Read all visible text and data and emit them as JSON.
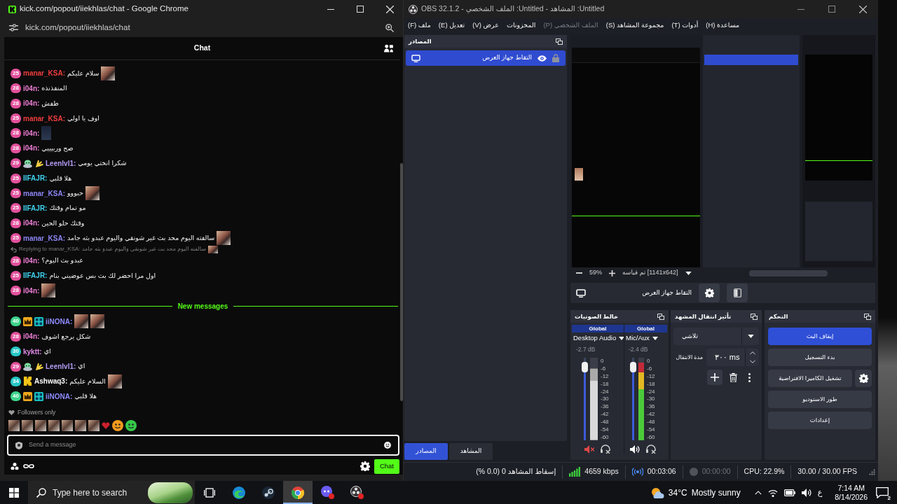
{
  "chrome": {
    "title": "kick.com/popout/iiekhlas/chat - Google Chrome",
    "url": "kick.com/popout/iiekhlas/chat"
  },
  "chat": {
    "title": "Chat",
    "messages": [
      {
        "kind": "message",
        "badge": {
          "text": "25",
          "color": "#e2519c"
        },
        "user": "manar_KSA:",
        "color": "#f23d3d",
        "text": "سلام عليكم",
        "attachments": [
          {
            "kind": "emote"
          }
        ]
      },
      {
        "kind": "message",
        "badge": {
          "text": "28",
          "color": "#e2519c"
        },
        "user": "i04n:",
        "color": "#ef7fd6",
        "text": "المنفذنذه"
      },
      {
        "kind": "message",
        "badge": {
          "text": "28",
          "color": "#e2519c"
        },
        "user": "i04n:",
        "color": "#ef7fd6",
        "text": "طفش"
      },
      {
        "kind": "message",
        "badge": {
          "text": "25",
          "color": "#e2519c"
        },
        "user": "manar_KSA:",
        "color": "#f23d3d",
        "text": "اوف يا اولي"
      },
      {
        "kind": "message",
        "badge": {
          "text": "28",
          "color": "#e2519c"
        },
        "user": "i04n:",
        "color": "#ef7fd6",
        "attachments": [
          {
            "kind": "sticker"
          }
        ]
      },
      {
        "kind": "message",
        "badge": {
          "text": "28",
          "color": "#e2519c"
        },
        "user": "i04n:",
        "color": "#ef7fd6",
        "text": "صح وربيييي"
      },
      {
        "kind": "message",
        "badge": {
          "text": "29",
          "color": "#e2519c"
        },
        "extra_badges": [
          {
            "kind": "alien"
          },
          {
            "kind": "hand"
          }
        ],
        "user": "Leenlvl1:",
        "color": "#b39cf3",
        "text": "شكرا انختي يومي"
      },
      {
        "kind": "message",
        "badge": {
          "text": "25",
          "color": "#e2519c"
        },
        "user": "IIFAJR:",
        "color": "#3fd2ee",
        "text": "هلا قلبي"
      },
      {
        "kind": "message",
        "badge": {
          "text": "25",
          "color": "#e2519c"
        },
        "user": "manar_KSA:",
        "color": "#8d86f4",
        "text": "حبووو",
        "attachments": [
          {
            "kind": "emote"
          }
        ]
      },
      {
        "kind": "message",
        "badge": {
          "text": "25",
          "color": "#e2519c"
        },
        "user": "IIFAJR:",
        "color": "#3fd2ee",
        "text": "مو تمام وقتك"
      },
      {
        "kind": "message",
        "badge": {
          "text": "28",
          "color": "#e2519c"
        },
        "user": "i04n:",
        "color": "#ef7fd6",
        "text": "وقتك حلو الحين"
      },
      {
        "kind": "message",
        "badge": {
          "text": "25",
          "color": "#e2519c"
        },
        "user": "manar_KSA:",
        "color": "#8d86f4",
        "text": "سالفته اليوم محد بث غير شونقي واليوم عبدو بثه جامد",
        "attachments": [
          {
            "kind": "emote"
          }
        ]
      },
      {
        "kind": "reply",
        "text": "Replying to manar_KSA: سالفته اليوم محد بث غير شونقي واليوم عبدو بثه جامد",
        "attachments": [
          {
            "kind": "emote"
          }
        ]
      },
      {
        "kind": "message",
        "badge": {
          "text": "28",
          "color": "#e2519c"
        },
        "user": "i04n:",
        "color": "#ef7fd6",
        "text": "عبدو بث اليوم؟"
      },
      {
        "kind": "message",
        "badge": {
          "text": "25",
          "color": "#e2519c"
        },
        "user": "IIFAJR:",
        "color": "#3fd2ee",
        "text": "اول مرا احضر لك بث بس عوضيني بنام"
      },
      {
        "kind": "message",
        "badge": {
          "text": "28",
          "color": "#e2519c"
        },
        "user": "i04n:",
        "color": "#ef7fd6",
        "attachments": [
          {
            "kind": "emote"
          }
        ]
      }
    ],
    "divider": "New messages",
    "new_messages": [
      {
        "kind": "message",
        "badge": {
          "text": "40",
          "color": "#3ed38b"
        },
        "extra_badges": [
          {
            "kind": "crown"
          },
          {
            "kind": "bars"
          }
        ],
        "user": "iiNONA:",
        "color": "#8f8cff",
        "attachments": [
          {
            "kind": "emote"
          },
          {
            "kind": "emote"
          }
        ]
      },
      {
        "kind": "message",
        "badge": {
          "text": "28",
          "color": "#e2519c"
        },
        "user": "i04n:",
        "color": "#ef7fd6",
        "text": "شكل يرجع اشوف"
      },
      {
        "kind": "message",
        "badge": {
          "text": "30",
          "color": "#27c6c6"
        },
        "user": "kyktt:",
        "color": "#e48be8",
        "text": "اي"
      },
      {
        "kind": "message",
        "badge": {
          "text": "29",
          "color": "#e2519c"
        },
        "extra_badges": [
          {
            "kind": "alien"
          },
          {
            "kind": "hand"
          }
        ],
        "user": "Leenlvl1:",
        "color": "#b39cf3",
        "text": "اي"
      },
      {
        "kind": "message",
        "badge": {
          "text": "34",
          "color": "#27c6c6"
        },
        "extra_badges": [
          {
            "kind": "letter"
          }
        ],
        "user": "Ashwaq3:",
        "color": "#ffffff",
        "text": "السلام عليكم",
        "attachments": [
          {
            "kind": "emote"
          }
        ]
      },
      {
        "kind": "message",
        "badge": {
          "text": "40",
          "color": "#3ed38b"
        },
        "extra_badges": [
          {
            "kind": "crown"
          },
          {
            "kind": "bars"
          }
        ],
        "user": "iiNONA:",
        "color": "#8f8cff",
        "text": "هلا قلبي"
      }
    ],
    "followers_only": "Followers only",
    "recent_emotes": [
      {
        "kind": "photo"
      },
      {
        "kind": "photo"
      },
      {
        "kind": "photo"
      },
      {
        "kind": "photo"
      },
      {
        "kind": "photo"
      },
      {
        "kind": "photo"
      },
      {
        "kind": "photo"
      },
      {
        "kind": "heart"
      },
      {
        "kind": "face",
        "color": "#f39a1e"
      },
      {
        "kind": "face",
        "color": "#35c94a"
      }
    ],
    "input_placeholder": "Send a message",
    "send_button": "Chat"
  },
  "obs": {
    "title": "OBS 32.1.2 - الملف الشخصي :Untitled - المشاهد :Untitled",
    "menu": [
      {
        "label": "مساعدة (H)",
        "disabled": false
      },
      {
        "label": "أدوات (T)",
        "disabled": false
      },
      {
        "label": "مجموعة المشاهد (S)",
        "disabled": false
      },
      {
        "label": "الملف الشخصي (P)",
        "disabled": true
      },
      {
        "label": "المخزونات",
        "disabled": false
      },
      {
        "label": "عرض (V)",
        "disabled": false
      },
      {
        "label": "تعديل (E)",
        "disabled": false
      },
      {
        "label": "ملف (F)",
        "disabled": false
      }
    ],
    "sources": {
      "title": "المصادر",
      "items": [
        {
          "label": "التقاط جهاز العرض",
          "selected": true,
          "visible": true
        }
      ]
    },
    "preview_toolbar": {
      "zoom": "59%",
      "scale": "تم قياسه [1141x642]"
    },
    "source_toolbar": {
      "label": "التقاط جهاز العرض"
    },
    "mixer": {
      "title": "خالط الصوتيات",
      "channels": [
        {
          "tag": "Global",
          "name": "Mic/Aux",
          "reading": "-2.4 dB",
          "muted": false,
          "volume": {
            "level": 0.9
          },
          "meter": {
            "level": 0.94
          },
          "scale": [
            "0",
            "-6",
            "-12",
            "-18",
            "-24",
            "-30",
            "-36",
            "-42",
            "-48",
            "-54",
            "-60"
          ]
        },
        {
          "tag": "Global",
          "name": "Desktop Audio",
          "reading": "-2.7 dB",
          "muted": true,
          "volume": {
            "level": 0.9
          },
          "meter": {
            "level": 0.87
          },
          "scale": [
            "0",
            "-6",
            "-12",
            "-18",
            "-24",
            "-30",
            "-36",
            "-42",
            "-48",
            "-54",
            "-60"
          ]
        }
      ]
    },
    "transitions": {
      "title": "تأثير انتقال المشهد",
      "effect": "تلاشي",
      "duration_label": "مدة الانتقال",
      "duration": "٣٠٠ ms"
    },
    "controls": {
      "title": "التحكم",
      "buttons": [
        {
          "label": "إيقاف البث",
          "active": true,
          "settings_button": false
        },
        {
          "label": "بدء التسجيل",
          "active": false,
          "settings_button": false
        },
        {
          "label": "تشغيل الكاميرا الافتراضية",
          "active": false,
          "settings_button": true
        },
        {
          "label": "طور الاستوديو",
          "active": false,
          "settings_button": false
        },
        {
          "label": "إعدادات",
          "active": false,
          "settings_button": false
        }
      ]
    },
    "tabs": [
      {
        "label": "المشاهد",
        "selected": false
      },
      {
        "label": "المصادر",
        "selected": true
      }
    ],
    "status": {
      "dropped_frames": "إسقاط المشاهد 0 (0.0 %)",
      "bitrate": "4659 kbps",
      "streaming": true,
      "stream_time": "00:03:06",
      "recording": false,
      "record_time": "00:00:00",
      "cpu": "CPU: 22.9%",
      "fps": "30.00 / 30.00 FPS"
    }
  },
  "taskbar": {
    "search_placeholder": "Type here to search",
    "apps": [
      {
        "kind": "taskview",
        "selected": false
      },
      {
        "kind": "edge",
        "selected": false
      },
      {
        "kind": "steam",
        "selected": false
      },
      {
        "kind": "chrome",
        "selected": true
      },
      {
        "kind": "messenger",
        "selected": false
      },
      {
        "kind": "obs",
        "selected": false
      }
    ],
    "weather": {
      "temperature": "34°C",
      "condition": "Mostly sunny"
    },
    "input_language": "ع",
    "time": "7:14 AM",
    "date": "8/14/2026",
    "notifications": "2"
  }
}
